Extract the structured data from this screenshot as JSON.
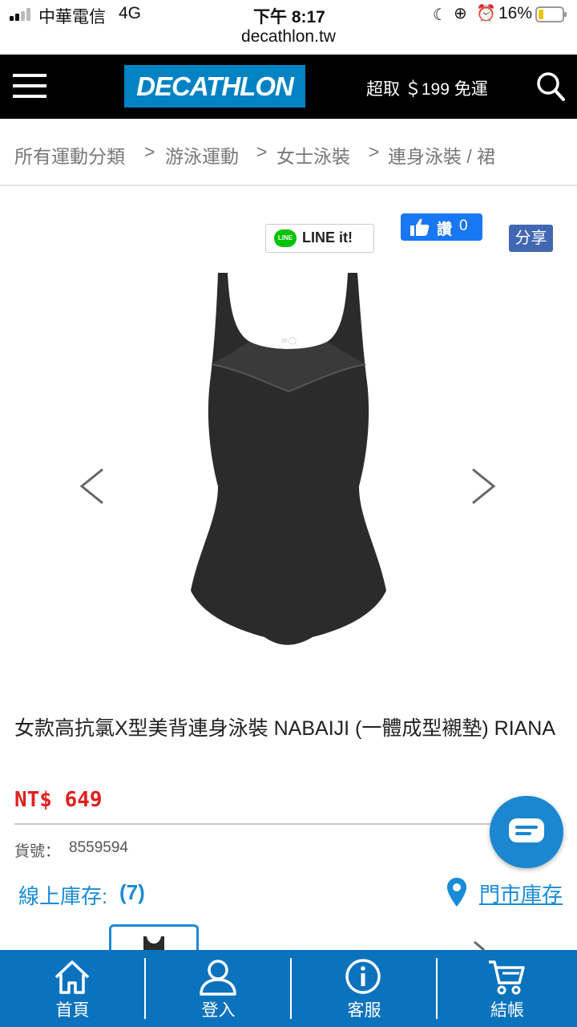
{
  "status_bar": {
    "carrier": "中華電信",
    "network": "4G",
    "time": "下午 8:17",
    "battery": "16%",
    "url": "decathlon.tw"
  },
  "header": {
    "logo": "DECATHLON",
    "promo": "超取 ＄199 免運"
  },
  "breadcrumb": {
    "items": [
      "所有運動分類",
      "游泳運動",
      "女士泳裝",
      "連身泳裝 / 裙"
    ],
    "separator": ">"
  },
  "share": {
    "line_label": "LINE it!",
    "line_badge": "LINE",
    "like_label": "讚",
    "like_count": "0",
    "share_label": "分享"
  },
  "product": {
    "title": "女款高抗氯X型美背連身泳裝 NABAIJI (一體成型襯墊) RIANA",
    "price": "NT$ 649",
    "sku_label": "貨號：",
    "sku": "8559594",
    "online_stock_label": "線上庫存:",
    "online_stock_count": "(7)",
    "store_stock_label": "門市庫存"
  },
  "bottom_nav": {
    "home": "首頁",
    "login": "登入",
    "service": "客服",
    "checkout": "結帳"
  },
  "colors": {
    "brand_blue": "#0082c3",
    "nav_blue": "#0b72bd",
    "price_red": "#e02020",
    "link_blue": "#1a8bd6"
  }
}
